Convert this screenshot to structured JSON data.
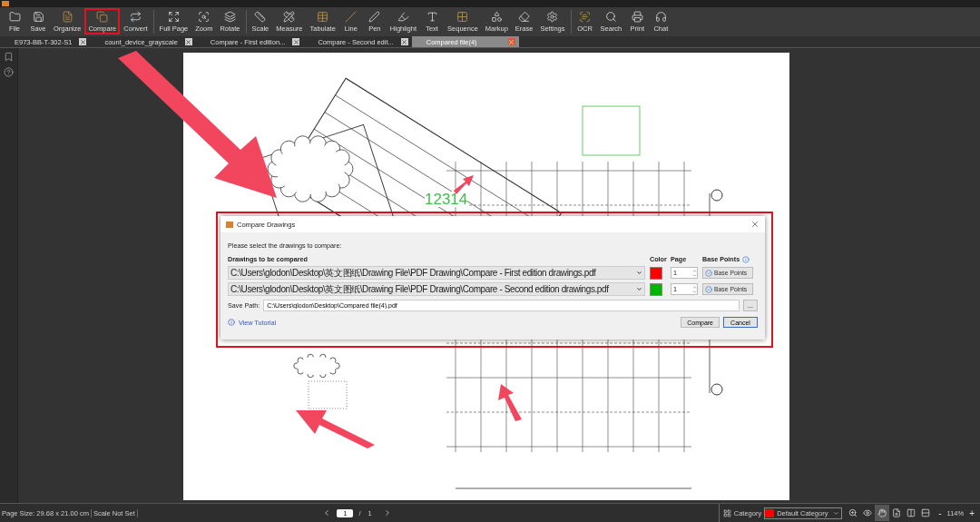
{
  "toolbar_groups": [
    {
      "items": [
        {
          "label": "File",
          "accent": false,
          "highlighted": false
        },
        {
          "label": "Save",
          "accent": false,
          "highlighted": false
        },
        {
          "label": "Organize",
          "accent": true,
          "highlighted": false
        },
        {
          "label": "Compare",
          "accent": true,
          "highlighted": true
        },
        {
          "label": "Convert",
          "accent": false,
          "highlighted": false
        }
      ]
    },
    {
      "items": [
        {
          "label": "Full Page",
          "accent": false,
          "highlighted": false
        },
        {
          "label": "Zoom",
          "accent": false,
          "highlighted": false
        },
        {
          "label": "Rotate",
          "accent": false,
          "highlighted": false
        }
      ]
    },
    {
      "items": [
        {
          "label": "Scale",
          "accent": false,
          "highlighted": false
        },
        {
          "label": "Measure",
          "accent": false,
          "highlighted": false
        },
        {
          "label": "Tabulate",
          "accent": true,
          "highlighted": false
        },
        {
          "label": "Line",
          "accent": true,
          "highlighted": false
        },
        {
          "label": "Pen",
          "accent": false,
          "highlighted": false
        },
        {
          "label": "Highlight",
          "accent": false,
          "highlighted": false
        },
        {
          "label": "Text",
          "accent": false,
          "highlighted": false
        },
        {
          "label": "Sequence",
          "accent": true,
          "highlighted": false
        },
        {
          "label": "Markup",
          "accent": false,
          "highlighted": false
        },
        {
          "label": "Erase",
          "accent": false,
          "highlighted": false
        },
        {
          "label": "Settings",
          "accent": false,
          "highlighted": false
        }
      ]
    },
    {
      "items": [
        {
          "label": "OCR",
          "accent": true,
          "highlighted": false
        },
        {
          "label": "Search",
          "accent": false,
          "highlighted": false
        },
        {
          "label": "Print",
          "accent": false,
          "highlighted": false
        },
        {
          "label": "Chat",
          "accent": false,
          "highlighted": false
        }
      ]
    }
  ],
  "tabs": [
    {
      "label": "E973-BB-T-302-S1",
      "selected": false
    },
    {
      "label": "count_device_grayscale",
      "selected": false
    },
    {
      "label": "Compare - First edition...",
      "selected": false
    },
    {
      "label": "Compare - Second edit...",
      "selected": false
    },
    {
      "label": "Compared file(4)",
      "selected": true
    }
  ],
  "page_annotation": "12314",
  "dialog": {
    "title": "Compare Drawings",
    "prompt": "Please select the drawings to compare:",
    "headers": {
      "files": "Drawings to be compared",
      "color_header": "Color",
      "page": "Page",
      "base_points": "Base Points"
    },
    "rows": [
      {
        "path": "C:\\Users\\glodon\\Desktop\\英文图纸\\Drawing File\\PDF Drawing\\Compare - First edition drawings.pdf",
        "color": "#ff0000",
        "page": "1",
        "button": "Base Points"
      },
      {
        "path": "C:\\Users\\glodon\\Desktop\\英文图纸\\Drawing File\\PDF Drawing\\Compare - Second edition drawings.pdf",
        "color": "#00b400",
        "page": "1",
        "button": "Base Points"
      }
    ],
    "save_path_label": "Save Path:",
    "save_path": "C:\\Users\\glodon\\Desktop\\Compared file(4).pdf",
    "browse": "...",
    "tutorial": "View Tutorial",
    "buttons": [
      {
        "label": "Compare",
        "default": false
      },
      {
        "label": "Cancel",
        "default": true
      }
    ]
  },
  "status_bar": {
    "page_size": "Page Size: 29.68 x 21.00 cm",
    "scale": "Scale Not Set",
    "page_input": "1",
    "page_sep": "/",
    "page_total": "1",
    "category_label": "Category",
    "category_value": "Default Category",
    "tools": [
      {
        "selected": false
      },
      {
        "selected": false
      },
      {
        "selected": true
      },
      {
        "selected": false
      },
      {
        "selected": false
      },
      {
        "selected": false
      }
    ],
    "zoom_out": "-",
    "zoom": "114%",
    "zoom_in": "+"
  }
}
